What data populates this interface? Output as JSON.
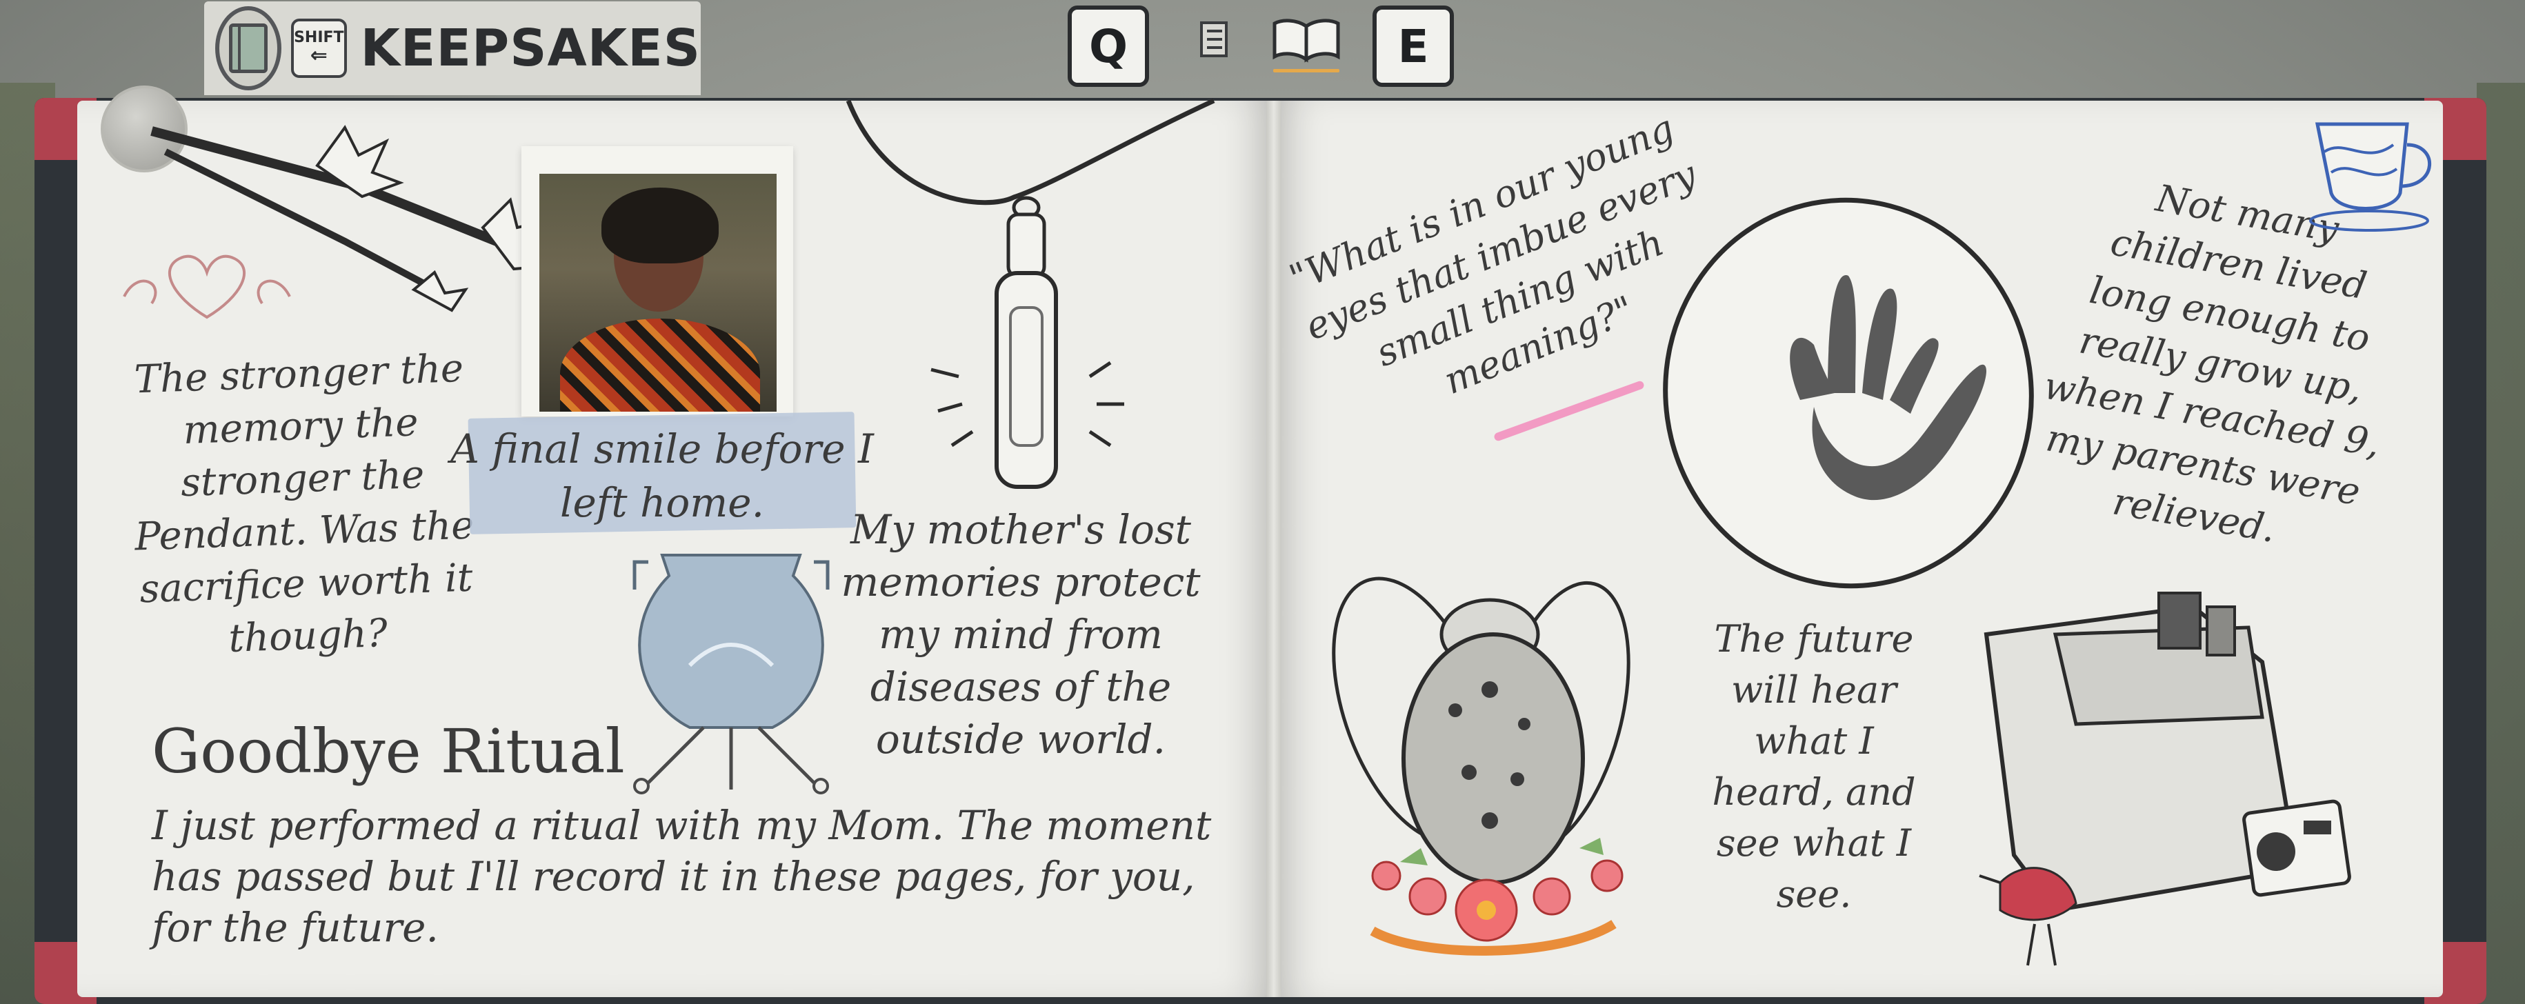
{
  "hud": {
    "title": "KEEPSAKES",
    "shift_label": "SHIFT",
    "shift_arrow": "⇐",
    "key_left": "Q",
    "key_right": "E",
    "tabs": [
      {
        "name": "list-icon"
      },
      {
        "name": "open-book-icon",
        "active": true
      }
    ]
  },
  "left_page": {
    "note_pendant": "The stronger the memory the stronger the Pendant. Was the sacrifice worth it though?",
    "photo_caption": "A final smile before I left home.",
    "note_mother": "My mother's lost memories protect my mind from diseases of the outside world.",
    "ritual_title": "Goodbye Ritual",
    "ritual_body": "I just performed a ritual with my Mom. The moment has passed but I'll record it in these pages, for you, for the future."
  },
  "right_page": {
    "quote": "\"What is in our young eyes that imbue every small thing with meaning?\"",
    "note_children": "Not many children lived long enough to really grow up, when I reached 9, my parents were relieved.",
    "note_future": "The future will hear what I heard, and see what I see."
  },
  "colors": {
    "page": "#eeeeea",
    "cover": "#2e3338",
    "corner": "#b0424f",
    "tab_underline": "#e6a94b",
    "tape": "#b7c6d9",
    "highlight": "#f29ac3"
  }
}
